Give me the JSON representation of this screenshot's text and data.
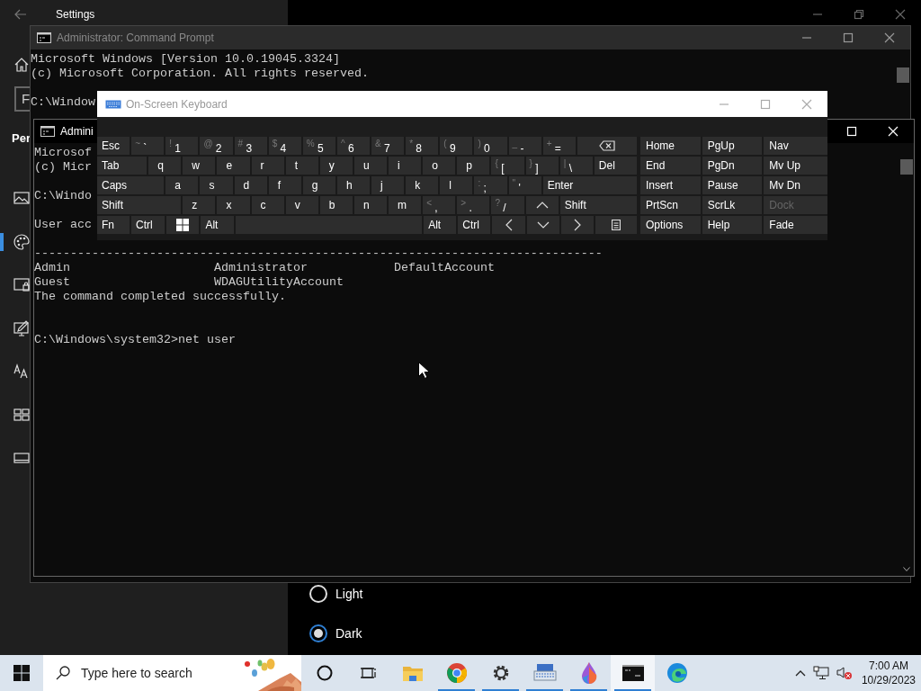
{
  "settings": {
    "title": "Settings",
    "search_partial": "F",
    "heading_partial": "Per",
    "nav_items": [
      {
        "kind": "picture",
        "selected": false
      },
      {
        "kind": "palette",
        "selected": true
      },
      {
        "kind": "lock",
        "selected": false
      },
      {
        "kind": "brush",
        "selected": false
      },
      {
        "kind": "font",
        "selected": false
      },
      {
        "kind": "start",
        "selected": false
      },
      {
        "kind": "taskbar",
        "selected": false
      }
    ],
    "theme_options": [
      {
        "label": "Light",
        "selected": false
      },
      {
        "label": "Dark",
        "selected": true
      }
    ]
  },
  "cmd_back": {
    "title": "Administrator: Command Prompt",
    "active": false,
    "output": "Microsoft Windows [Version 10.0.19045.3324]\n(c) Microsoft Corporation. All rights reserved.\n\nC:\\Window"
  },
  "cmd_front": {
    "title": "Admini",
    "active": true,
    "output": "Microsof\n(c) Micr\n\nC:\\Windo\n\nUser acc\n\n-------------------------------------------------------------------------------\nAdmin                    Administrator            DefaultAccount\nGuest                    WDAGUtilityAccount\nThe command completed successfully.\n\n\nC:\\Windows\\system32>net user"
  },
  "keyboard": {
    "title": "On-Screen Keyboard",
    "active": false,
    "rows": [
      {
        "keys": [
          {
            "kind": "word",
            "label": "Esc"
          },
          {
            "kind": "dual",
            "shift": "~",
            "label": "`"
          },
          {
            "kind": "dual",
            "shift": "!",
            "label": "1"
          },
          {
            "kind": "dual",
            "shift": "@",
            "label": "2"
          },
          {
            "kind": "dual",
            "shift": "#",
            "label": "3"
          },
          {
            "kind": "dual",
            "shift": "$",
            "label": "4"
          },
          {
            "kind": "dual",
            "shift": "%",
            "label": "5"
          },
          {
            "kind": "dual",
            "shift": "^",
            "label": "6"
          },
          {
            "kind": "dual",
            "shift": "&",
            "label": "7"
          },
          {
            "kind": "dual",
            "shift": "*",
            "label": "8"
          },
          {
            "kind": "dual",
            "shift": "(",
            "label": "9"
          },
          {
            "kind": "dual",
            "shift": ")",
            "label": "0"
          },
          {
            "kind": "dual",
            "shift": "_",
            "label": "-"
          },
          {
            "kind": "dual",
            "shift": "+",
            "label": "="
          },
          {
            "kind": "backspace"
          }
        ]
      },
      {
        "keys": [
          {
            "kind": "word",
            "label": "Tab"
          },
          {
            "kind": "letter",
            "label": "q"
          },
          {
            "kind": "letter",
            "label": "w"
          },
          {
            "kind": "letter",
            "label": "e"
          },
          {
            "kind": "letter",
            "label": "r"
          },
          {
            "kind": "letter",
            "label": "t"
          },
          {
            "kind": "letter",
            "label": "y"
          },
          {
            "kind": "letter",
            "label": "u"
          },
          {
            "kind": "letter",
            "label": "i"
          },
          {
            "kind": "letter",
            "label": "o"
          },
          {
            "kind": "letter",
            "label": "p"
          },
          {
            "kind": "dual",
            "shift": "{",
            "label": "["
          },
          {
            "kind": "dual",
            "shift": "}",
            "label": "]"
          },
          {
            "kind": "dual",
            "shift": "|",
            "label": "\\"
          },
          {
            "kind": "word",
            "label": "Del"
          }
        ]
      },
      {
        "keys": [
          {
            "kind": "word",
            "label": "Caps"
          },
          {
            "kind": "letter",
            "label": "a"
          },
          {
            "kind": "letter",
            "label": "s"
          },
          {
            "kind": "letter",
            "label": "d"
          },
          {
            "kind": "letter",
            "label": "f"
          },
          {
            "kind": "letter",
            "label": "g"
          },
          {
            "kind": "letter",
            "label": "h"
          },
          {
            "kind": "letter",
            "label": "j"
          },
          {
            "kind": "letter",
            "label": "k"
          },
          {
            "kind": "letter",
            "label": "l"
          },
          {
            "kind": "dual",
            "shift": ":",
            "label": ";"
          },
          {
            "kind": "dual",
            "shift": "\"",
            "label": "'"
          },
          {
            "kind": "word",
            "label": "Enter"
          }
        ]
      },
      {
        "keys": [
          {
            "kind": "word",
            "label": "Shift"
          },
          {
            "kind": "letter",
            "label": "z"
          },
          {
            "kind": "letter",
            "label": "x"
          },
          {
            "kind": "letter",
            "label": "c"
          },
          {
            "kind": "letter",
            "label": "v"
          },
          {
            "kind": "letter",
            "label": "b"
          },
          {
            "kind": "letter",
            "label": "n"
          },
          {
            "kind": "letter",
            "label": "m"
          },
          {
            "kind": "dual",
            "shift": "<",
            "label": ","
          },
          {
            "kind": "dual",
            "shift": ">",
            "label": "."
          },
          {
            "kind": "dual",
            "shift": "?",
            "label": "/"
          },
          {
            "kind": "up"
          },
          {
            "kind": "word",
            "label": "Shift"
          }
        ]
      },
      {
        "keys": [
          {
            "kind": "word",
            "label": "Fn"
          },
          {
            "kind": "word",
            "label": "Ctrl"
          },
          {
            "kind": "windows"
          },
          {
            "kind": "word",
            "label": "Alt"
          },
          {
            "kind": "space"
          },
          {
            "kind": "word",
            "label": "Alt"
          },
          {
            "kind": "word",
            "label": "Ctrl"
          },
          {
            "kind": "left"
          },
          {
            "kind": "down"
          },
          {
            "kind": "right"
          },
          {
            "kind": "menu"
          }
        ]
      }
    ],
    "nav_keys": [
      {
        "label": "Home",
        "disabled": false
      },
      {
        "label": "PgUp",
        "disabled": false
      },
      {
        "label": "Nav",
        "disabled": false
      },
      {
        "label": "End",
        "disabled": false
      },
      {
        "label": "PgDn",
        "disabled": false
      },
      {
        "label": "Mv Up",
        "disabled": false
      },
      {
        "label": "Insert",
        "disabled": false
      },
      {
        "label": "Pause",
        "disabled": false
      },
      {
        "label": "Mv Dn",
        "disabled": false
      },
      {
        "label": "PrtScn",
        "disabled": false
      },
      {
        "label": "ScrLk",
        "disabled": false
      },
      {
        "label": "Dock",
        "disabled": true
      },
      {
        "label": "Options",
        "disabled": false
      },
      {
        "label": "Help",
        "disabled": false
      },
      {
        "label": "Fade",
        "disabled": false
      }
    ]
  },
  "taskbar": {
    "search_placeholder": "Type here to search",
    "apps": [
      {
        "kind": "cortana",
        "running": false,
        "active": false
      },
      {
        "kind": "taskview",
        "running": false,
        "active": false
      },
      {
        "kind": "folder",
        "running": false,
        "active": false
      },
      {
        "kind": "chrome",
        "running": true,
        "active": false
      },
      {
        "kind": "gear",
        "running": true,
        "active": false
      },
      {
        "kind": "keyboard",
        "running": true,
        "active": false
      },
      {
        "kind": "paint",
        "running": true,
        "active": false
      },
      {
        "kind": "console",
        "running": true,
        "active": true
      },
      {
        "kind": "edge",
        "running": false,
        "active": false
      }
    ],
    "time": "7:00 AM",
    "date": "10/29/2023"
  }
}
